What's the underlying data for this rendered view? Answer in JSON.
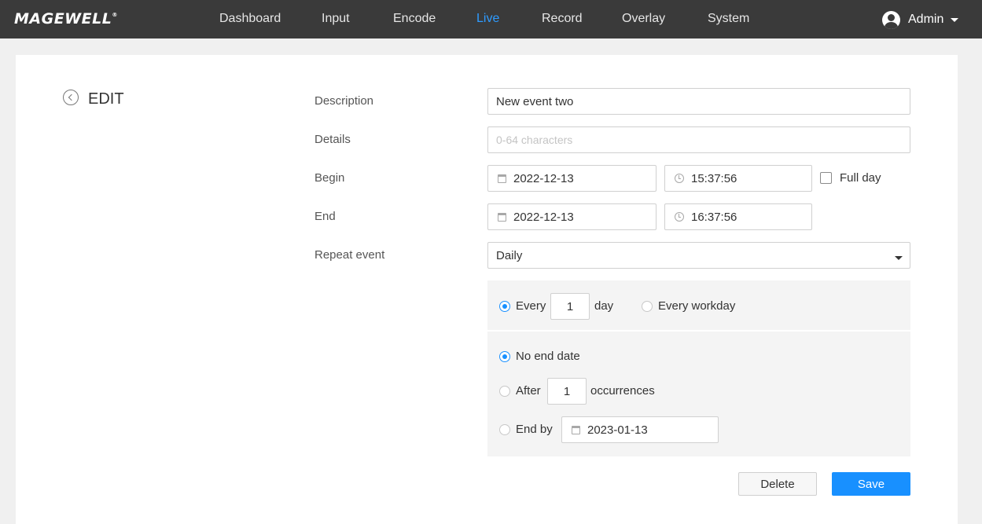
{
  "header": {
    "logo": "MAGEWELL",
    "logo_mark": "®",
    "nav": [
      {
        "label": "Dashboard",
        "active": false
      },
      {
        "label": "Input",
        "active": false
      },
      {
        "label": "Encode",
        "active": false
      },
      {
        "label": "Live",
        "active": true
      },
      {
        "label": "Record",
        "active": false
      },
      {
        "label": "Overlay",
        "active": false
      },
      {
        "label": "System",
        "active": false
      }
    ],
    "user": "Admin"
  },
  "page": {
    "title": "EDIT"
  },
  "form": {
    "description_label": "Description",
    "description_value": "New event two",
    "details_label": "Details",
    "details_placeholder": "0-64 characters",
    "begin_label": "Begin",
    "begin_date": "2022-12-13",
    "begin_time": "15:37:56",
    "full_day_label": "Full day",
    "full_day_checked": false,
    "end_label": "End",
    "end_date": "2022-12-13",
    "end_time": "16:37:56",
    "repeat_label": "Repeat event",
    "repeat_value": "Daily"
  },
  "repeat": {
    "every_label": "Every",
    "every_value": "1",
    "day_label": "day",
    "every_workday_label": "Every workday",
    "selected": "every",
    "no_end_label": "No end date",
    "after_label": "After",
    "after_value": "1",
    "occurrences_label": "occurrences",
    "end_by_label": "End by",
    "end_by_date": "2023-01-13",
    "end_selected": "no_end"
  },
  "actions": {
    "delete_label": "Delete",
    "save_label": "Save"
  },
  "colors": {
    "topbar": "#3a3a3a",
    "accent": "#1890ff",
    "active_nav": "#2e9bff",
    "panel": "#f4f4f4"
  }
}
